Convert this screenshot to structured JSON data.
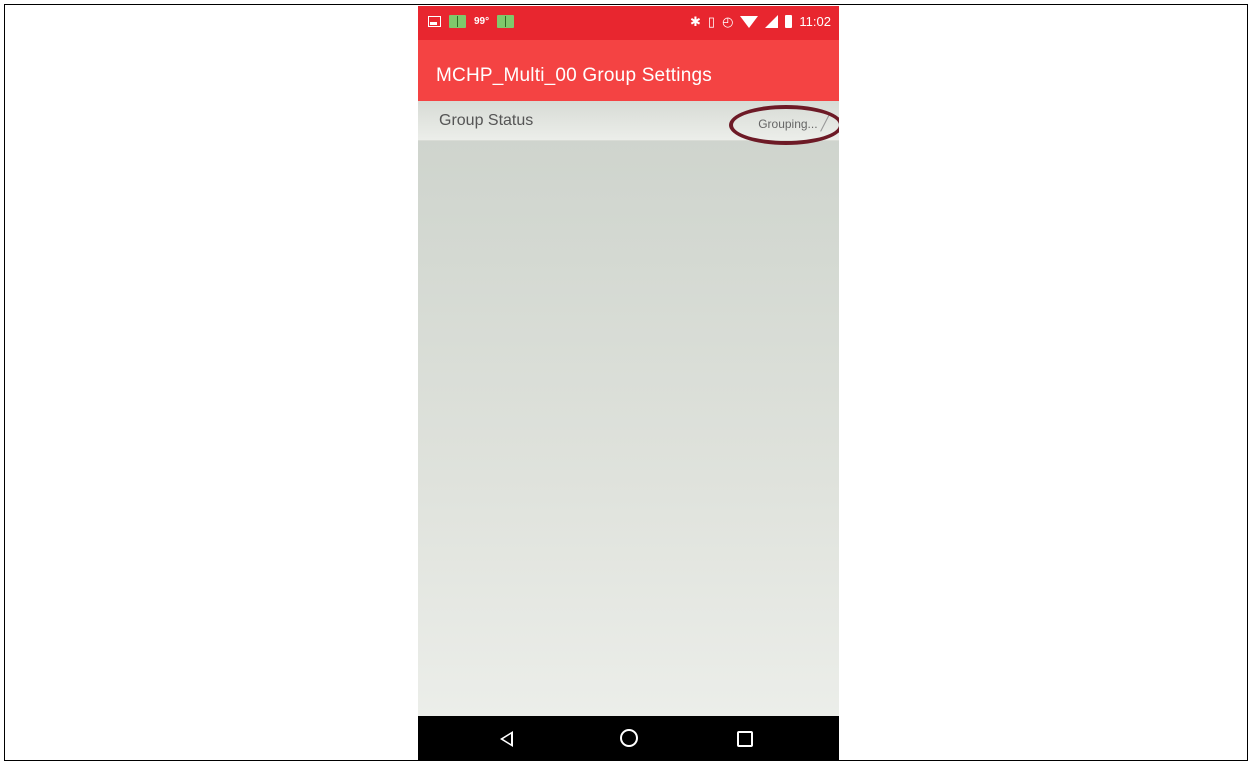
{
  "status_bar": {
    "temperature": "99°",
    "time": "11:02",
    "icons": [
      "image-icon",
      "book-icon",
      "book-icon",
      "bluetooth-icon",
      "vibrate-icon",
      "alarm-icon",
      "wifi-icon",
      "signal-icon",
      "battery-icon"
    ]
  },
  "app_bar": {
    "title": "MCHP_Multi_00 Group Settings"
  },
  "settings": {
    "group_status_label": "Group Status",
    "group_status_value": "Grouping..."
  },
  "colors": {
    "status_bar": "#e8262f",
    "app_bar": "#f44343",
    "highlight": "#6d1a26"
  }
}
